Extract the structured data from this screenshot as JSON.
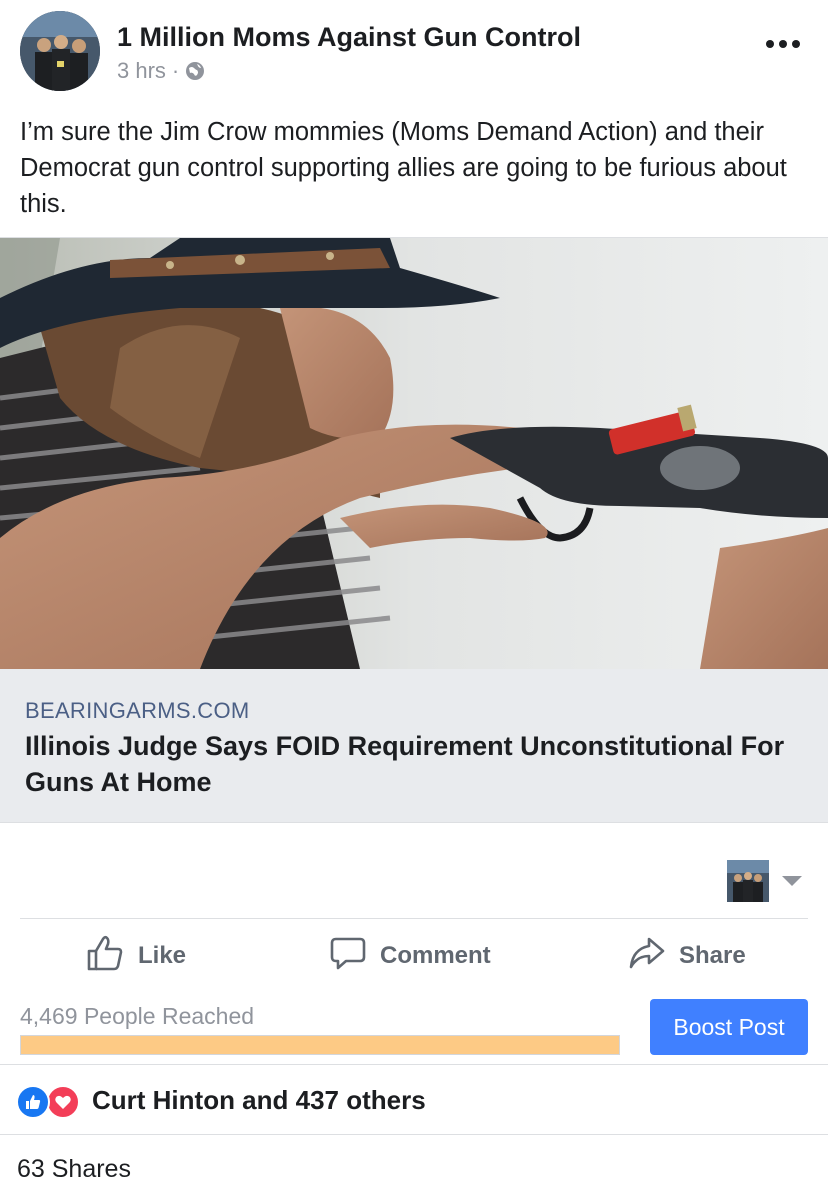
{
  "post": {
    "page_name": "1 Million Moms Against Gun Control",
    "time": "3 hrs",
    "separator": "·",
    "privacy_icon": "globe-icon",
    "more_icon": "more-dots-icon",
    "text": "I’m sure the Jim Crow mommies (Moms Demand Action) and their Democrat gun control supporting allies are going to be furious about this."
  },
  "link": {
    "domain": "BEARINGARMS.COM",
    "title": "Illinois Judge Says FOID Requirement Unconstitutional For Guns At Home"
  },
  "actions": {
    "like_label": "Like",
    "comment_label": "Comment",
    "share_label": "Share",
    "like_icon": "thumbs-up-icon",
    "comment_icon": "comment-bubble-icon",
    "share_icon": "share-arrow-icon"
  },
  "insights": {
    "reach_text": "4,469 People Reached",
    "reach_fraction": 1.0,
    "boost_label": "Boost Post"
  },
  "reactions": {
    "text": "Curt Hinton and 437 others"
  },
  "shares": {
    "text": "63 Shares"
  },
  "colors": {
    "accent": "#4080ff",
    "reach_fill": "#fdca85",
    "link_domain": "#4b5f85",
    "muted": "#90949c",
    "like_reaction": "#1877f2",
    "love_reaction": "#f33e58"
  }
}
